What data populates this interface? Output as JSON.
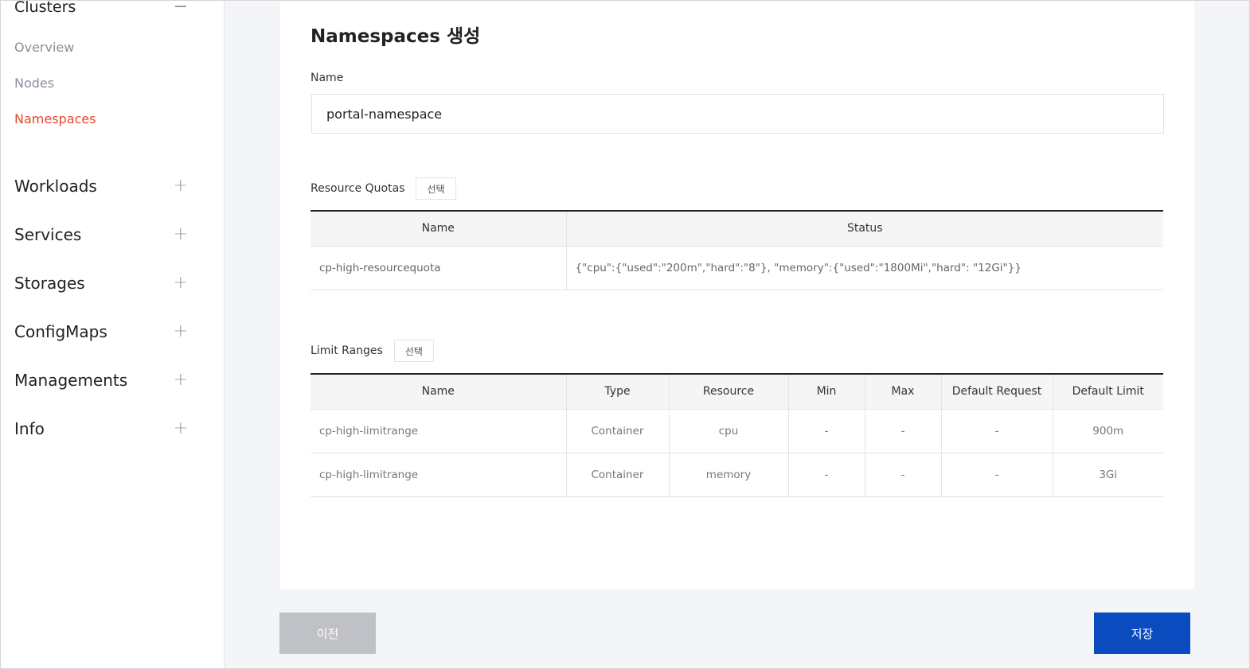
{
  "sidebar": {
    "cluster_title": "Clusters",
    "cluster_toggle": "−",
    "sub_items": [
      {
        "label": "Overview"
      },
      {
        "label": "Nodes"
      },
      {
        "label": "Namespaces"
      }
    ],
    "groups": [
      {
        "label": "Workloads",
        "toggle": "+"
      },
      {
        "label": "Services",
        "toggle": "+"
      },
      {
        "label": "Storages",
        "toggle": "+"
      },
      {
        "label": "ConfigMaps",
        "toggle": "+"
      },
      {
        "label": "Managements",
        "toggle": "+"
      },
      {
        "label": "Info",
        "toggle": "+"
      }
    ]
  },
  "main": {
    "title": "Namespaces 생성",
    "name_label": "Name",
    "name_value": "portal-namespace",
    "resource_quotas": {
      "label": "Resource Quotas",
      "select_label": "선택",
      "headers": [
        "Name",
        "Status"
      ],
      "rows": [
        [
          "cp-high-resourcequota",
          "{\"cpu\":{\"used\":\"200m\",\"hard\":\"8\"}, \"memory\":{\"used\":\"1800Mi\",\"hard\": \"12Gi\"}}"
        ]
      ]
    },
    "limit_ranges": {
      "label": "Limit Ranges",
      "select_label": "선택",
      "headers": [
        "Name",
        "Type",
        "Resource",
        "Min",
        "Max",
        "Default Request",
        "Default Limit"
      ],
      "rows": [
        [
          "cp-high-limitrange",
          "Container",
          "cpu",
          "-",
          "-",
          "-",
          "900m"
        ],
        [
          "cp-high-limitrange",
          "Container",
          "memory",
          "-",
          "-",
          "-",
          "3Gi"
        ]
      ]
    }
  },
  "footer": {
    "prev_label": "이전",
    "save_label": "저장"
  },
  "colors": {
    "active": "#e8452c",
    "primary": "#0a4bbf",
    "disabled": "#c0c1c6"
  }
}
